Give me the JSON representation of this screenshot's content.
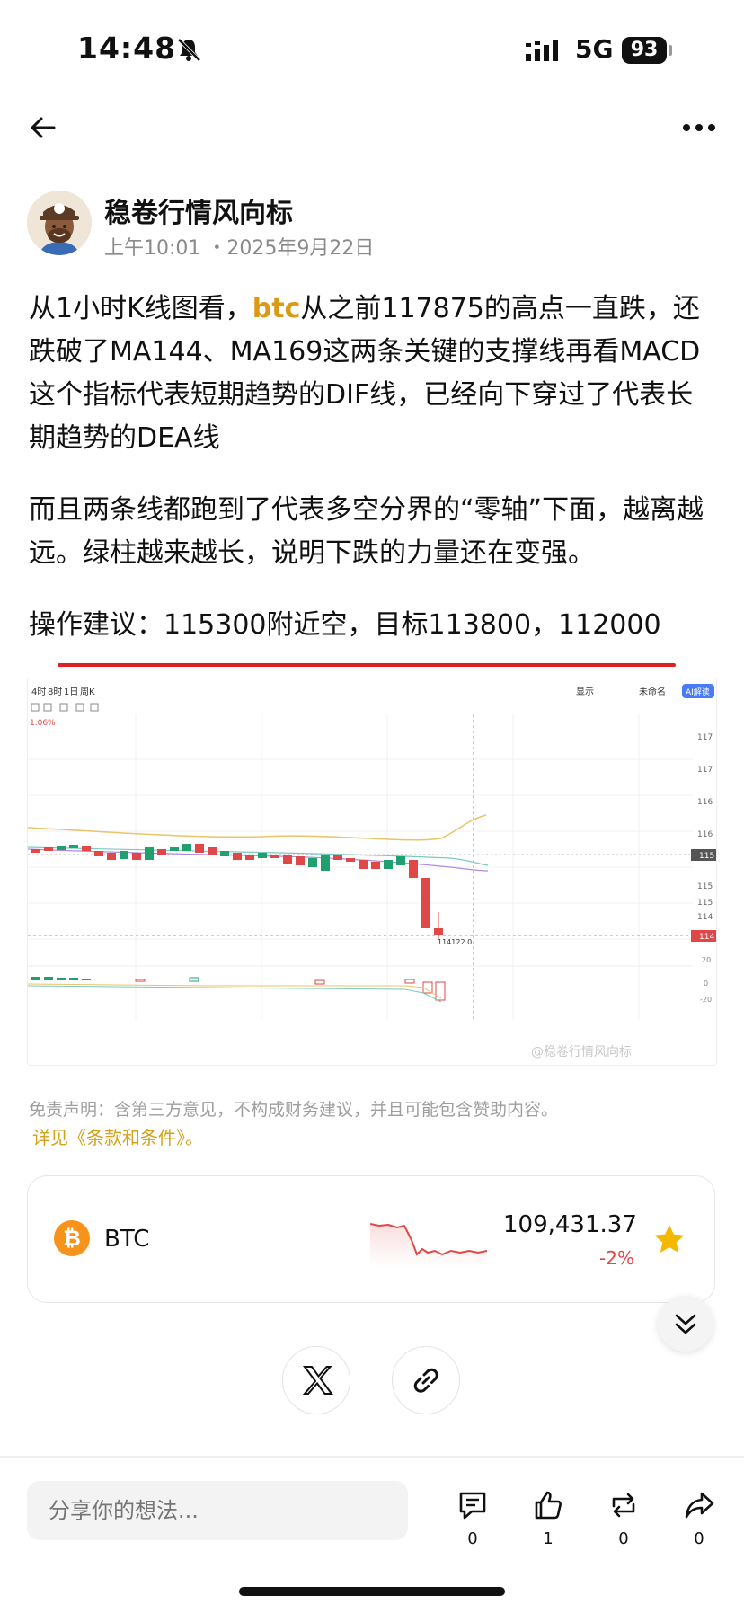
{
  "status_bar": {
    "time": "14:48",
    "network": "5G",
    "battery": "93"
  },
  "author": {
    "name": "稳卷行情风向标",
    "time": "上午10:01 ・2025年9月22日"
  },
  "post": {
    "p1_before": "从1小时K线图看，",
    "p1_highlight": "btc",
    "p1_after": "从之前117875的高点一直跌，还跌破了MA144、MA169这两条关键的支撑线再看MACD这个指标代表短期趋势的DIF线，已经向下穿过了代表长期趋势的DEA线",
    "p2": "而且两条线都跑到了代表多空分界的“零轴”下面，越离越远。绿柱越来越长，说明下跌的力量还在变强。",
    "p3": "操作建议：115300附近空，目标113800，112000"
  },
  "chart_image": {
    "tabs": [
      "4时",
      "8时",
      "1日",
      "周K"
    ],
    "toolbar_right": [
      "显示",
      "未命名"
    ],
    "ai_badge": "AI解读",
    "pct_label": "1.06%",
    "price_ticks": [
      "117",
      "117",
      "116",
      "116",
      "115",
      "115",
      "114"
    ],
    "current_tag": "115",
    "low_tag": "114",
    "low_label": "114122.0",
    "macd_ticks": [
      "20",
      "0",
      "-20"
    ],
    "watermark": "@稳卷行情风向标"
  },
  "disclaimer": "免责声明：含第三方意见，不构成财务建议，并且可能包含赞助内容。",
  "terms_link": "详见《条款和条件》。",
  "ticker": {
    "symbol": "BTC",
    "price": "109,431.37",
    "change": "-2%",
    "colors": {
      "down": "#e04747",
      "brand": "#f7931a",
      "star": "#f5b800"
    }
  },
  "comment": {
    "placeholder": "分享你的想法..."
  },
  "actions": {
    "comment_count": "0",
    "like_count": "1",
    "repost_count": "0",
    "share_count": "0"
  }
}
